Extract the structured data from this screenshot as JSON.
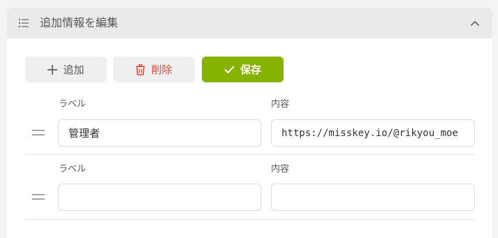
{
  "header": {
    "title": "追加情報を編集",
    "list_icon": "list-icon",
    "collapse_icon": "chevron-up-icon"
  },
  "toolbar": {
    "add_label": "追加",
    "delete_label": "削除",
    "save_label": "保存",
    "add_icon": "plus-icon",
    "delete_icon": "trash-icon",
    "save_icon": "check-icon"
  },
  "fields": [
    {
      "label_caption": "ラベル",
      "content_caption": "内容",
      "label_value": "管理者",
      "content_value": "https://misskey.io/@rikyou_moe"
    },
    {
      "label_caption": "ラベル",
      "content_caption": "内容",
      "label_value": "",
      "content_value": ""
    }
  ],
  "colors": {
    "accent": "#86b300",
    "danger": "#e4473b",
    "header_bg": "#eaeaea"
  }
}
